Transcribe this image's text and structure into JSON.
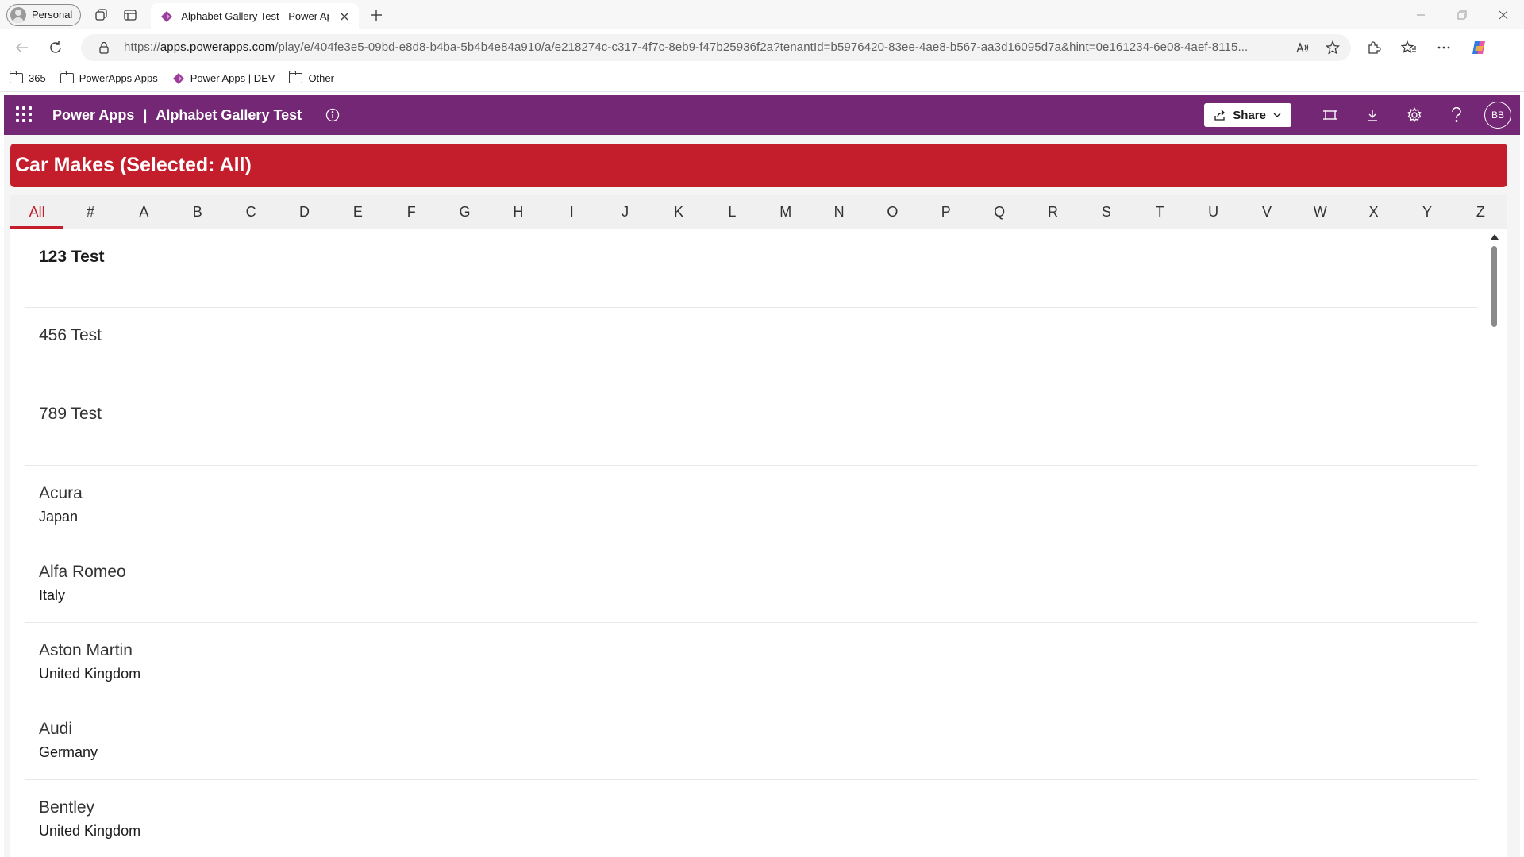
{
  "browser": {
    "profile_label": "Personal",
    "tab_title": "Alphabet Gallery Test - Power Apps",
    "url_prefix": "https://",
    "url_domain": "apps.powerapps.com",
    "url_rest": "/play/e/404fe3e5-09bd-e8d8-b4ba-5b4b4e84a910/a/e218274c-c317-4f7c-8eb9-f47b25936f2a?tenantId=b5976420-83ee-4ae8-b567-aa3d16095d7a&hint=0e161234-6e08-4aef-8115...",
    "bookmarks": [
      {
        "label": "365",
        "icon": "folder-icon"
      },
      {
        "label": "PowerApps Apps",
        "icon": "folder-icon"
      },
      {
        "label": "Power Apps | DEV",
        "icon": "powerapps-icon"
      },
      {
        "label": "Other",
        "icon": "folder-icon"
      }
    ]
  },
  "header": {
    "product": "Power Apps",
    "separator": "|",
    "app_name": "Alphabet Gallery Test",
    "share_label": "Share",
    "avatar_initials": "BB",
    "brand_color": "#742774"
  },
  "banner": {
    "title": "Car Makes (Selected: All)",
    "color": "#c41e2c"
  },
  "letters": {
    "items": [
      "All",
      "#",
      "A",
      "B",
      "C",
      "D",
      "E",
      "F",
      "G",
      "H",
      "I",
      "J",
      "K",
      "L",
      "M",
      "N",
      "O",
      "P",
      "Q",
      "R",
      "S",
      "T",
      "U",
      "V",
      "W",
      "X",
      "Y",
      "Z"
    ],
    "selected": "All"
  },
  "gallery": {
    "rows": [
      {
        "title": "123 Test",
        "subtitle": ""
      },
      {
        "title": "456 Test",
        "subtitle": ""
      },
      {
        "title": "789 Test",
        "subtitle": ""
      },
      {
        "title": "Acura",
        "subtitle": "Japan"
      },
      {
        "title": "Alfa Romeo",
        "subtitle": "Italy"
      },
      {
        "title": "Aston Martin",
        "subtitle": "United Kingdom"
      },
      {
        "title": "Audi",
        "subtitle": "Germany"
      },
      {
        "title": "Bentley",
        "subtitle": "United Kingdom"
      }
    ]
  }
}
